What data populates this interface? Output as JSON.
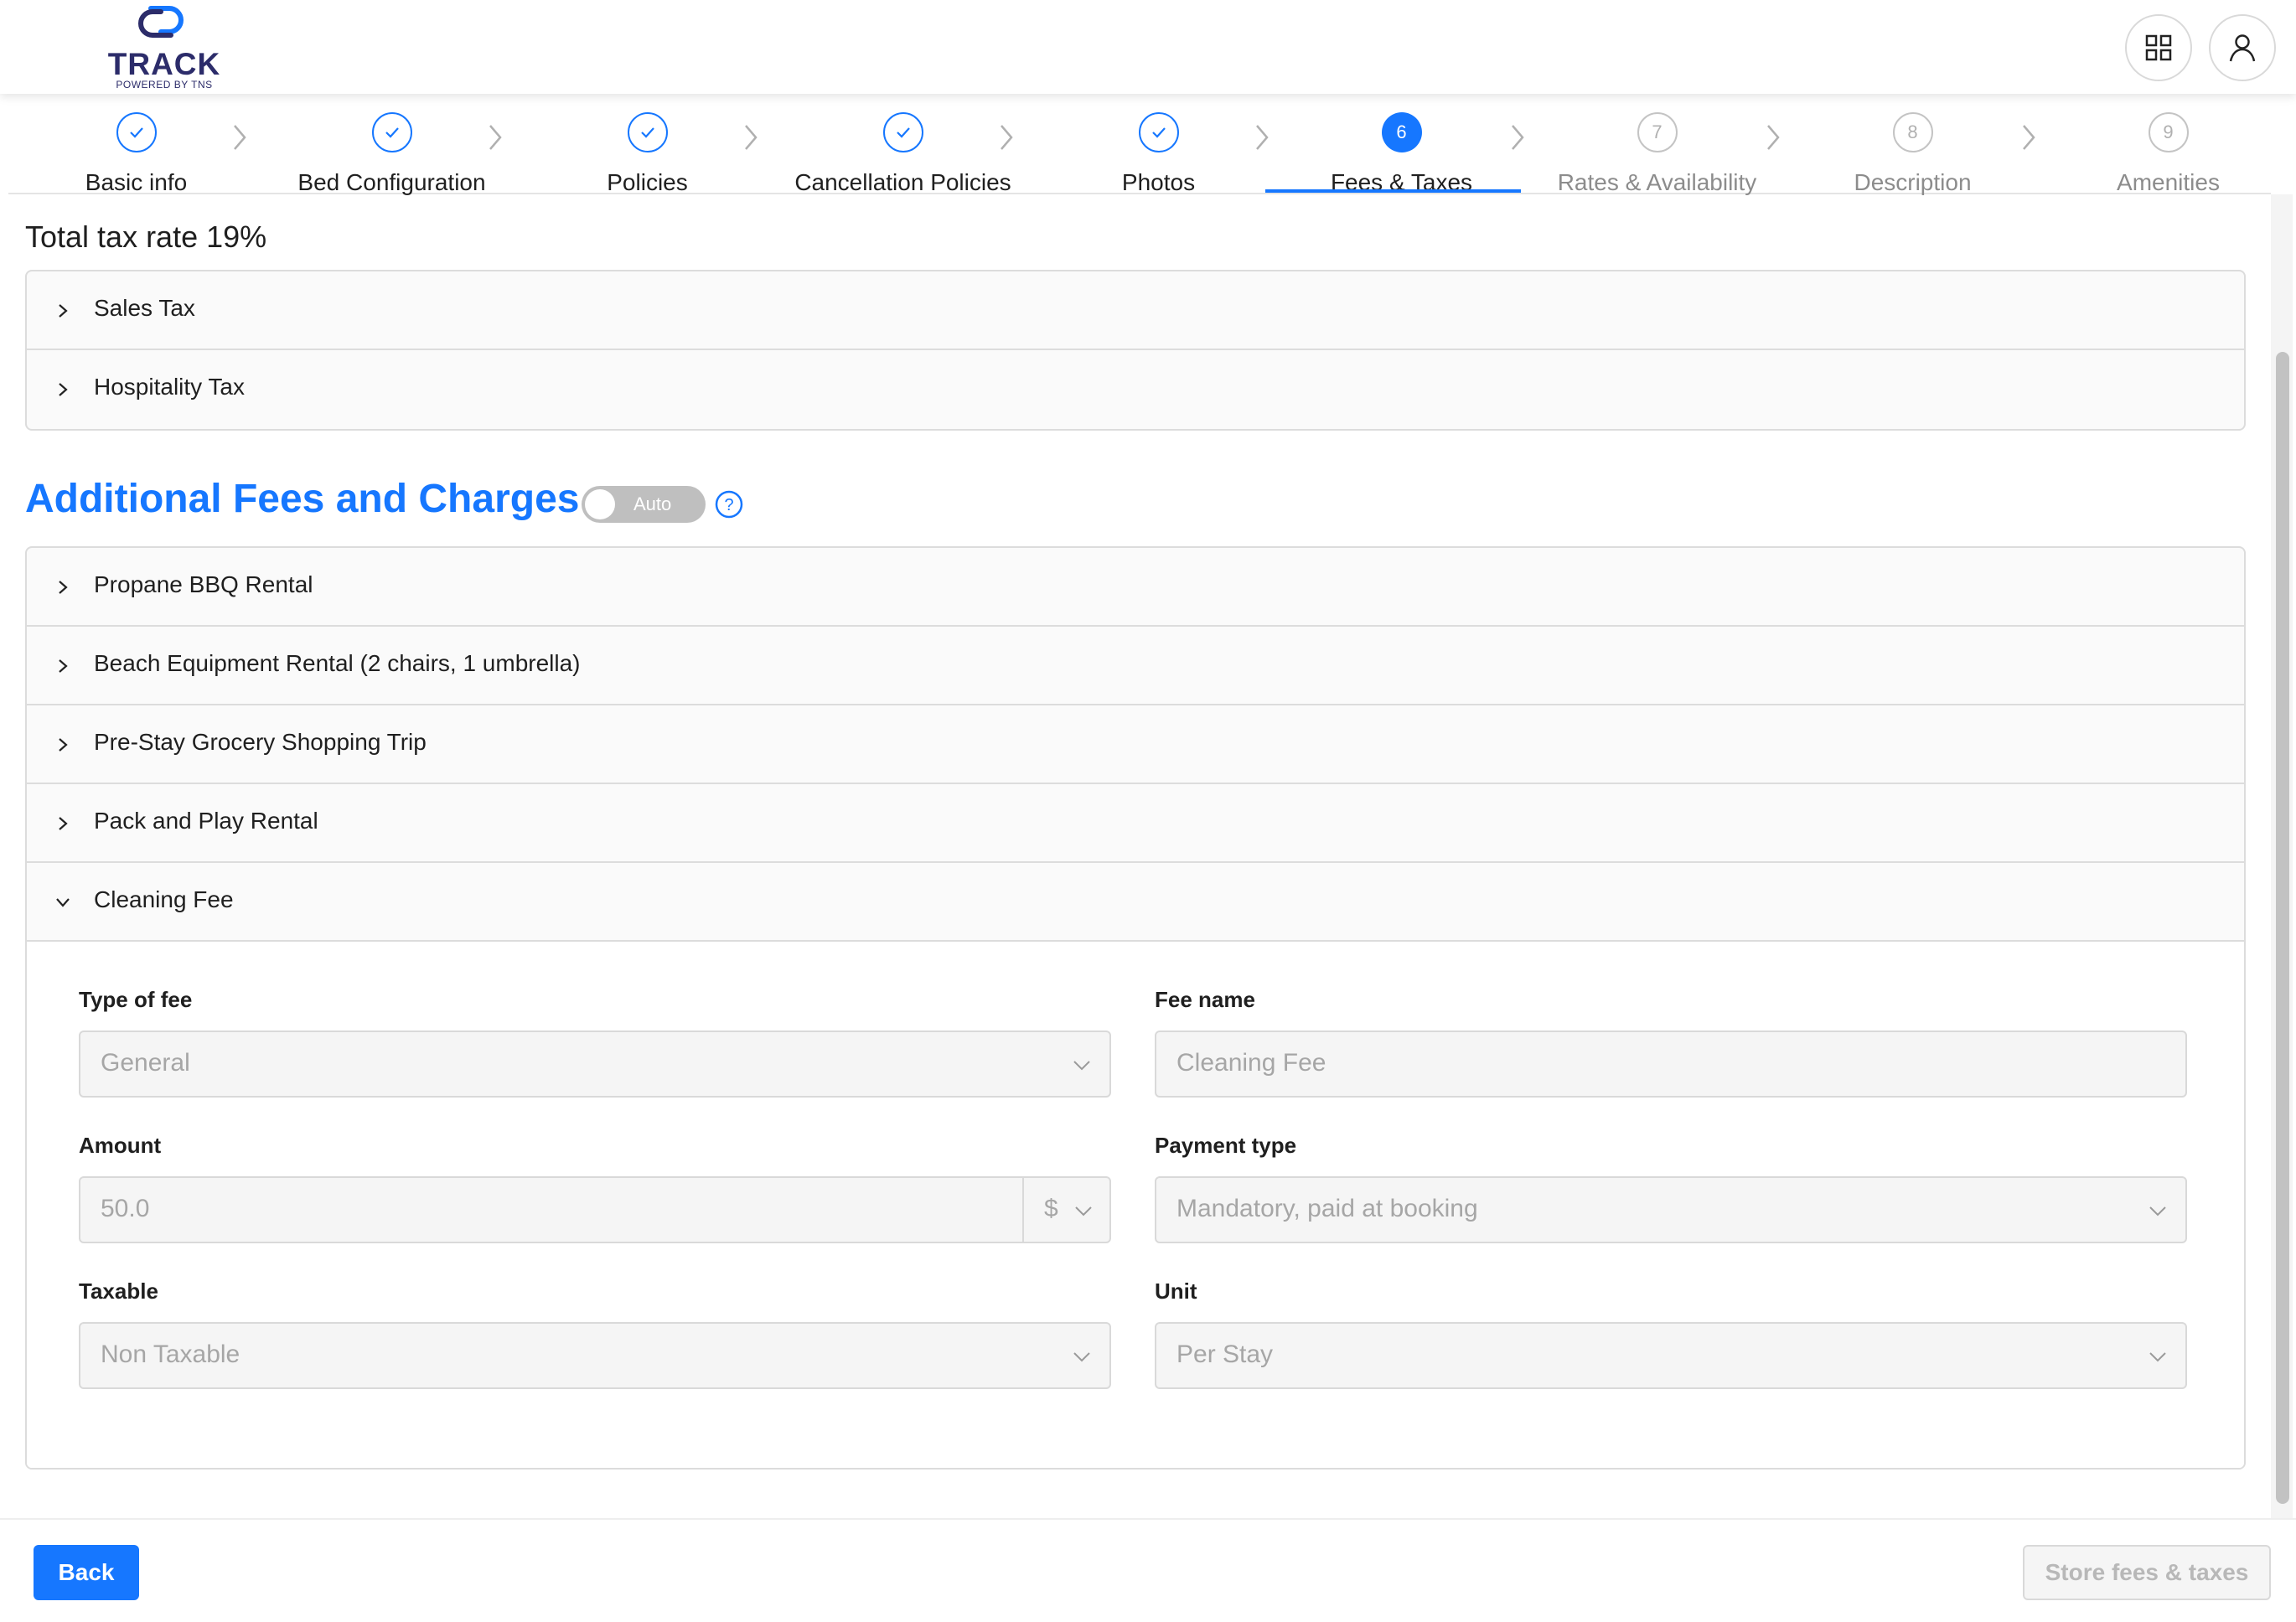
{
  "header": {
    "logo_text": "TRACK",
    "logo_sub": "POWERED BY TNS",
    "icons": [
      "apps-grid-icon",
      "user-icon"
    ]
  },
  "steps": [
    {
      "num": "1",
      "label": "Basic info",
      "status": "done"
    },
    {
      "num": "2",
      "label": "Bed Configuration",
      "status": "done"
    },
    {
      "num": "3",
      "label": "Policies",
      "status": "done"
    },
    {
      "num": "4",
      "label": "Cancellation Policies",
      "status": "done"
    },
    {
      "num": "5",
      "label": "Photos",
      "status": "done"
    },
    {
      "num": "6",
      "label": "Fees & Taxes",
      "status": "active"
    },
    {
      "num": "7",
      "label": "Rates & Availability",
      "status": "pending"
    },
    {
      "num": "8",
      "label": "Description",
      "status": "pending"
    },
    {
      "num": "9",
      "label": "Amenities",
      "status": "pending"
    }
  ],
  "taxes": {
    "total_label": "Total tax rate 19%",
    "items": [
      "Sales Tax",
      "Hospitality Tax"
    ]
  },
  "fees": {
    "title": "Additional Fees and Charges",
    "toggle_label": "Auto",
    "items": [
      "Propane BBQ Rental",
      "Beach Equipment Rental (2 chairs, 1 umbrella)",
      "Pre-Stay Grocery Shopping Trip",
      "Pack and Play Rental",
      "Cleaning Fee"
    ],
    "expanded": {
      "type_label": "Type of fee",
      "type_value": "General",
      "name_label": "Fee name",
      "name_value": "Cleaning Fee",
      "amount_label": "Amount",
      "amount_value": "50.0",
      "currency": "$",
      "payment_label": "Payment type",
      "payment_value": "Mandatory, paid at booking",
      "taxable_label": "Taxable",
      "taxable_value": "Non Taxable",
      "unit_label": "Unit",
      "unit_value": "Per Stay"
    }
  },
  "footer": {
    "back_label": "Back",
    "store_label": "Store fees & taxes"
  },
  "colors": {
    "accent": "#1677ff",
    "logo": "#2c2c6a",
    "border": "#dcdcdc"
  }
}
